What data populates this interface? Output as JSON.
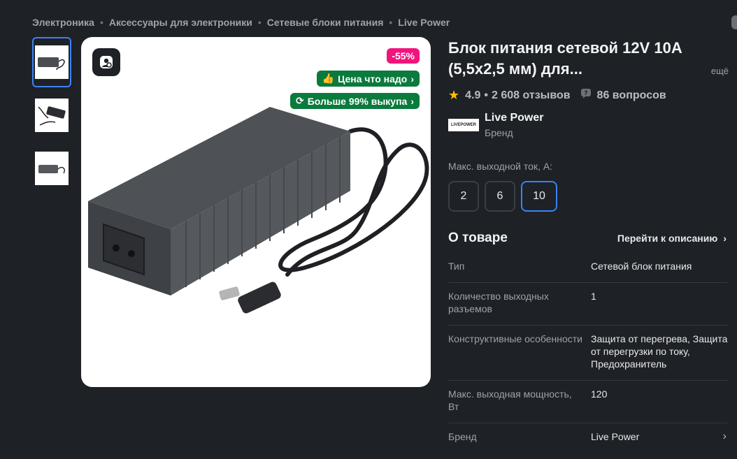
{
  "breadcrumb": [
    "Электроника",
    "Аксессуары для электроники",
    "Сетевые блоки питания",
    "Live Power"
  ],
  "gallery": {
    "thumbnails": [
      "adapter-front",
      "adapter-with-cables",
      "adapter-side"
    ],
    "badges": {
      "discount": "-55%",
      "price_badge": "Цена что надо",
      "buyout_badge": "Больше 99% выкупа"
    }
  },
  "product": {
    "title": "Блок питания сетевой 12V 10A (5,5x2,5 мм) для...",
    "more_label": "ещё",
    "rating": "4.9",
    "reviews": "2 608 отзывов",
    "questions": "86 вопросов"
  },
  "brand": {
    "name": "Live Power",
    "subtitle": "Бренд",
    "logo_text": "LIVEPOWER"
  },
  "options": {
    "label": "Макс. выходной ток, А:",
    "values": [
      "2",
      "6",
      "10"
    ],
    "selected": "10"
  },
  "about": {
    "title": "О товаре",
    "link": "Перейти к описанию",
    "specs": [
      {
        "key": "Тип",
        "value": "Сетевой блок питания"
      },
      {
        "key": "Количество выходных разъемов",
        "value": "1"
      },
      {
        "key": "Конструктивные особенности",
        "value": "Защита от перегрева, Защита от перегрузки по току, Предохранитель"
      },
      {
        "key": "Макс. выходная мощность, Вт",
        "value": "120"
      },
      {
        "key": "Бренд",
        "value": "Live Power"
      }
    ]
  },
  "colors": {
    "background": "#1e2126",
    "accent": "#3b82f6",
    "discount": "#f0147d",
    "green_badge": "#0a7a3d",
    "star": "#ffbf00"
  }
}
